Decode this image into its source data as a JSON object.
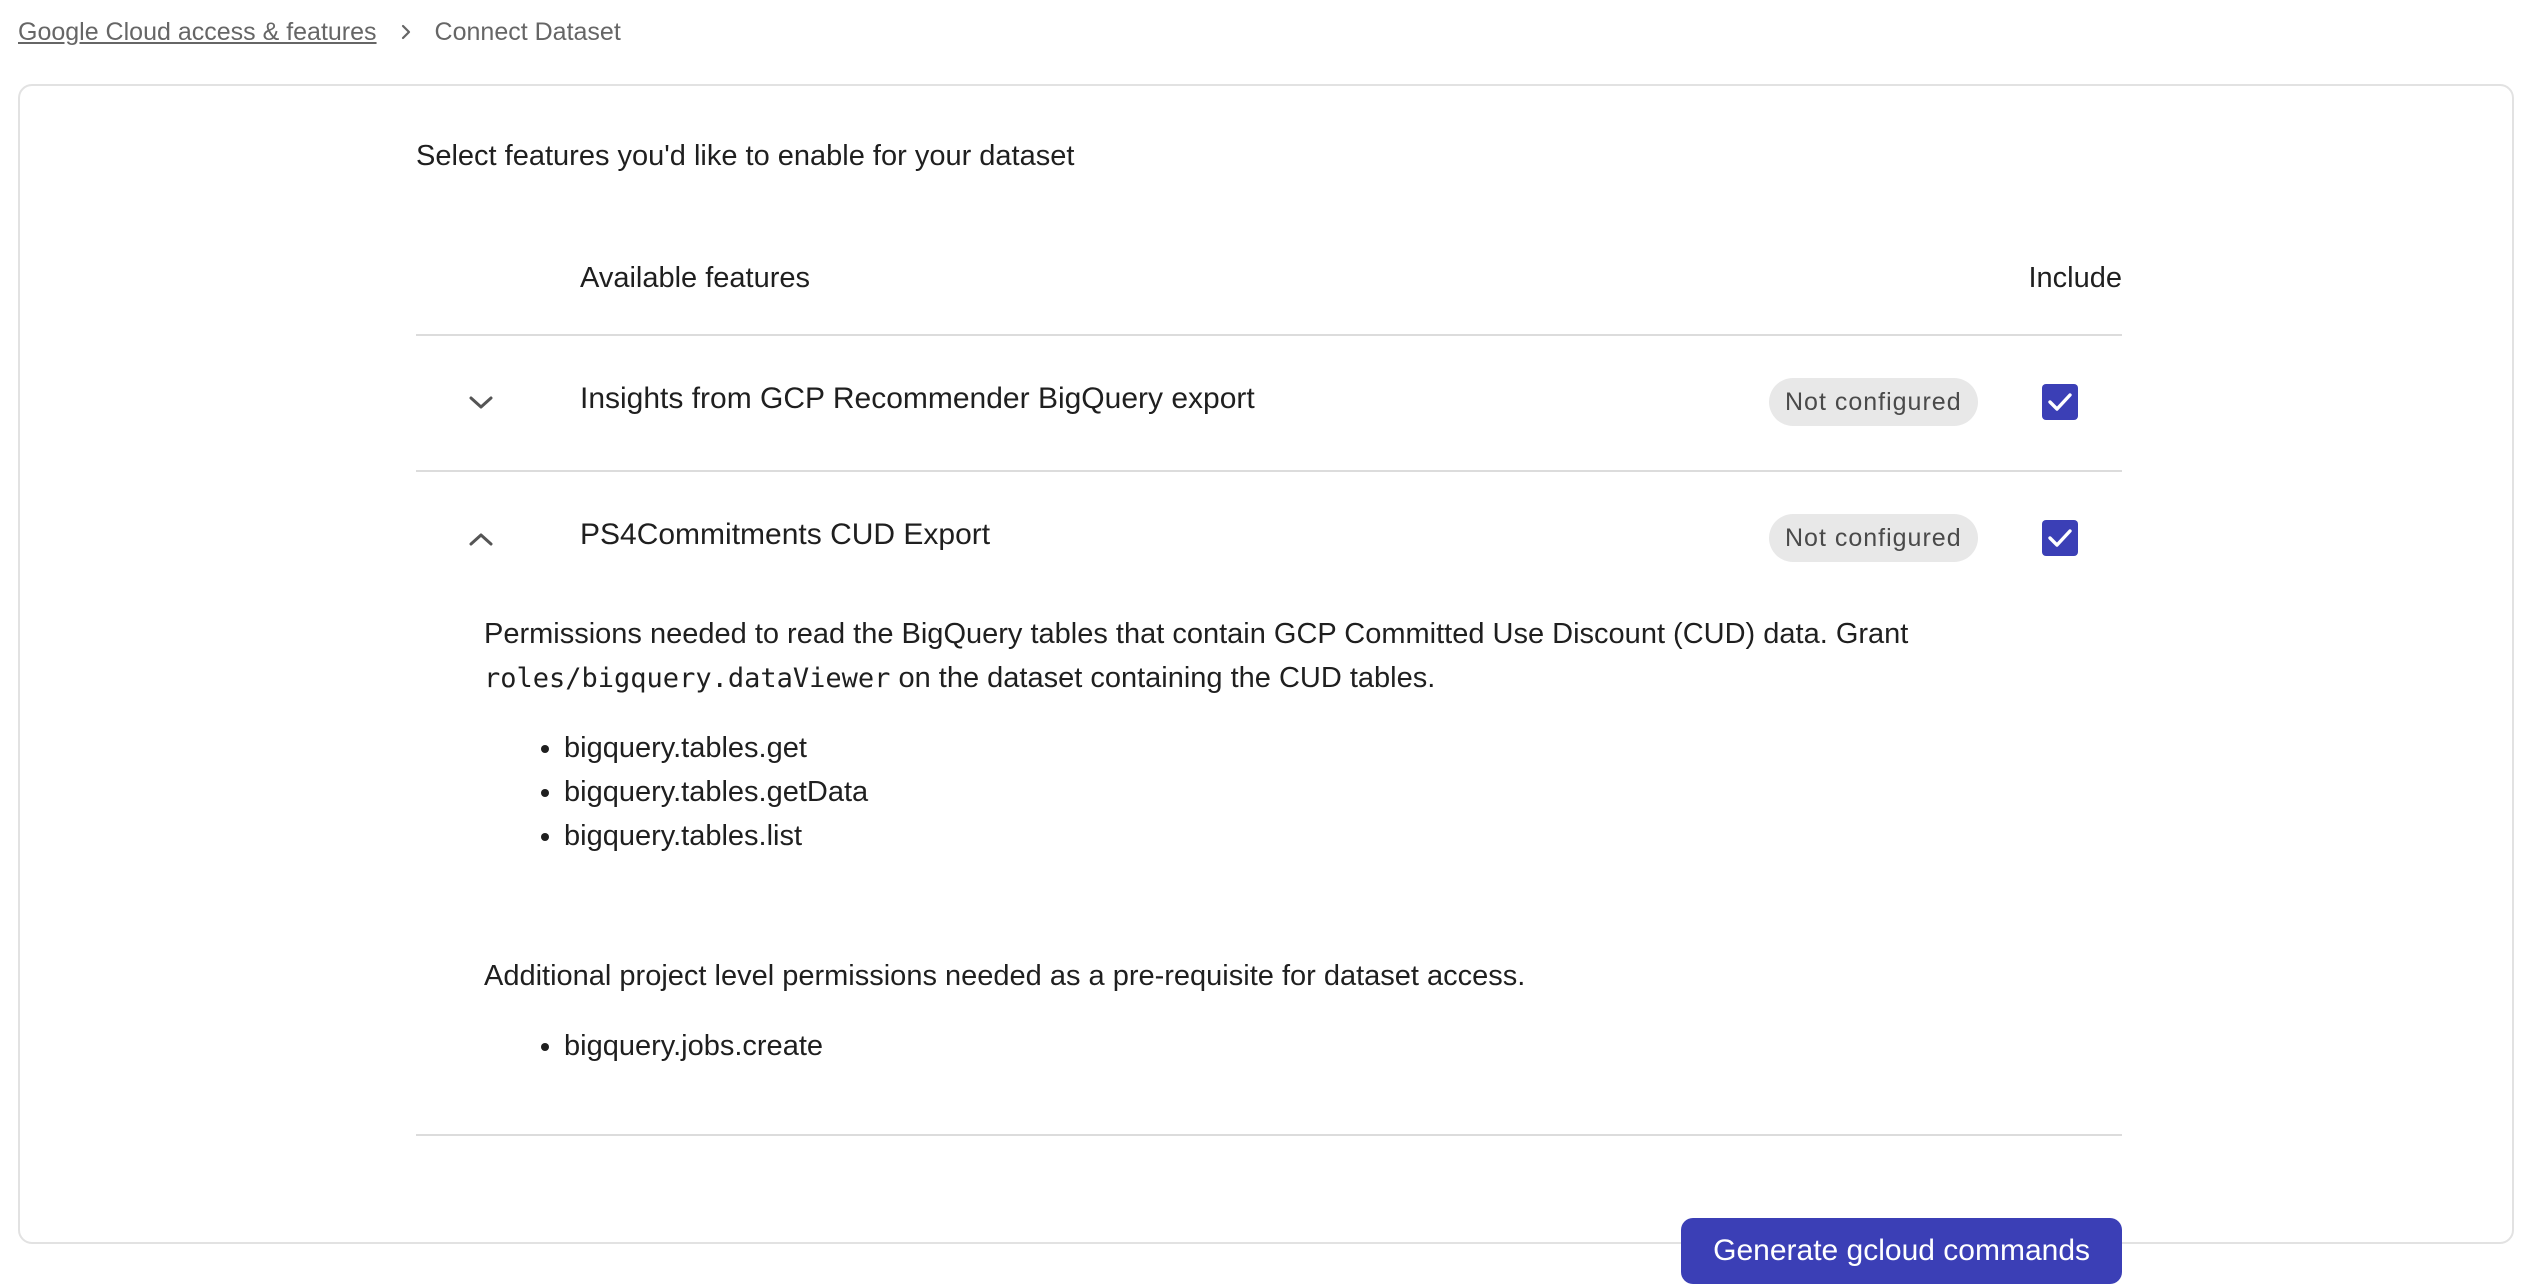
{
  "breadcrumb": {
    "parent": "Google Cloud access & features",
    "separator_icon": "chevron-right-icon",
    "current": "Connect Dataset"
  },
  "intro": "Select features you'd like to enable for your dataset",
  "table": {
    "col_features": "Available features",
    "col_include": "Include"
  },
  "features": [
    {
      "name": "Insights from GCP Recommender BigQuery export",
      "status": "Not configured",
      "included": true,
      "expanded": false,
      "chevron_icon": "chevron-down-icon"
    },
    {
      "name": "PS4Commitments CUD Export",
      "status": "Not configured",
      "included": true,
      "expanded": true,
      "chevron_icon": "chevron-up-icon"
    }
  ],
  "details": {
    "p1_before": "Permissions needed to read the BigQuery tables that contain GCP Committed Use Discount (CUD) data. Grant ",
    "p1_code": "roles/bigquery.dataViewer",
    "p1_after": " on the dataset containing the CUD tables.",
    "permissions": [
      "bigquery.tables.get",
      "bigquery.tables.getData",
      "bigquery.tables.list"
    ],
    "p2": "Additional project level permissions needed as a pre-requisite for dataset access.",
    "project_permissions": [
      "bigquery.jobs.create"
    ]
  },
  "actions": {
    "generate_label": "Generate gcloud commands"
  },
  "colors": {
    "accent": "#3b3fb6",
    "badge_bg": "#e8e8e8",
    "divider": "#dcdcdc"
  }
}
